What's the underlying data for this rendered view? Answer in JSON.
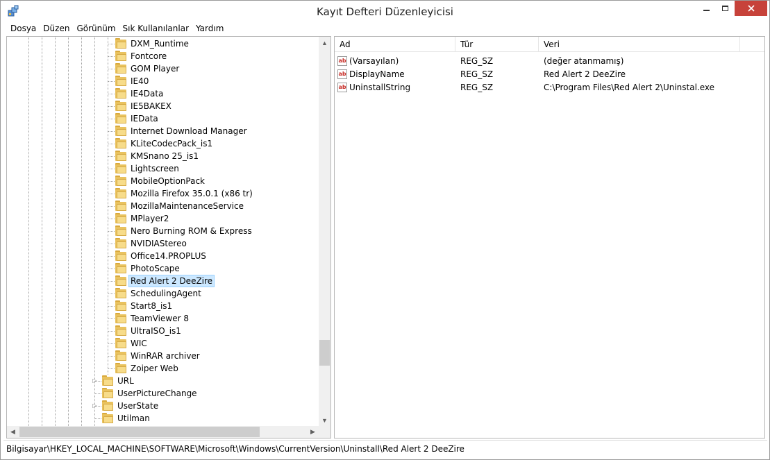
{
  "window": {
    "title": "Kayıt Defteri Düzenleyicisi",
    "close_color": "#c7423a"
  },
  "menu": [
    "Dosya",
    "Düzen",
    "Görünüm",
    "Sık Kullanılanlar",
    "Yardım"
  ],
  "tree": {
    "items": [
      {
        "label": "DXM_Runtime",
        "level": 2
      },
      {
        "label": "Fontcore",
        "level": 2
      },
      {
        "label": "GOM Player",
        "level": 2
      },
      {
        "label": "IE40",
        "level": 2
      },
      {
        "label": "IE4Data",
        "level": 2
      },
      {
        "label": "IE5BAKEX",
        "level": 2
      },
      {
        "label": "IEData",
        "level": 2
      },
      {
        "label": "Internet Download Manager",
        "level": 2
      },
      {
        "label": "KLiteCodecPack_is1",
        "level": 2
      },
      {
        "label": "KMSnano 25_is1",
        "level": 2
      },
      {
        "label": "Lightscreen",
        "level": 2
      },
      {
        "label": "MobileOptionPack",
        "level": 2
      },
      {
        "label": "Mozilla Firefox 35.0.1 (x86 tr)",
        "level": 2
      },
      {
        "label": "MozillaMaintenanceService",
        "level": 2
      },
      {
        "label": "MPlayer2",
        "level": 2
      },
      {
        "label": "Nero Burning ROM & Express",
        "level": 2
      },
      {
        "label": "NVIDIAStereo",
        "level": 2
      },
      {
        "label": "Office14.PROPLUS",
        "level": 2
      },
      {
        "label": "PhotoScape",
        "level": 2
      },
      {
        "label": "Red Alert 2 DeeZire",
        "level": 2,
        "selected": true
      },
      {
        "label": "SchedulingAgent",
        "level": 2
      },
      {
        "label": "Start8_is1",
        "level": 2
      },
      {
        "label": "TeamViewer 8",
        "level": 2
      },
      {
        "label": "UltraISO_is1",
        "level": 2
      },
      {
        "label": "WIC",
        "level": 2
      },
      {
        "label": "WinRAR archiver",
        "level": 2
      },
      {
        "label": "Zoiper Web",
        "level": 2
      },
      {
        "label": "URL",
        "level": 1,
        "expandable": true
      },
      {
        "label": "UserPictureChange",
        "level": 1
      },
      {
        "label": "UserState",
        "level": 1,
        "expandable": true
      },
      {
        "label": "Utilman",
        "level": 1
      }
    ]
  },
  "values": {
    "columns": {
      "name": "Ad",
      "type": "Tür",
      "data": "Veri"
    },
    "rows": [
      {
        "name": "(Varsayılan)",
        "type": "REG_SZ",
        "data": "(değer atanmamış)"
      },
      {
        "name": "DisplayName",
        "type": "REG_SZ",
        "data": "Red Alert 2 DeeZire"
      },
      {
        "name": "UninstallString",
        "type": "REG_SZ",
        "data": "C:\\Program Files\\Red Alert 2\\Uninstal.exe"
      }
    ]
  },
  "status": {
    "path": "Bilgisayar\\HKEY_LOCAL_MACHINE\\SOFTWARE\\Microsoft\\Windows\\CurrentVersion\\Uninstall\\Red Alert 2 DeeZire"
  },
  "icons": {
    "app": "registry-editor-icon",
    "folder": "folder-icon",
    "value": "string-value-icon"
  }
}
